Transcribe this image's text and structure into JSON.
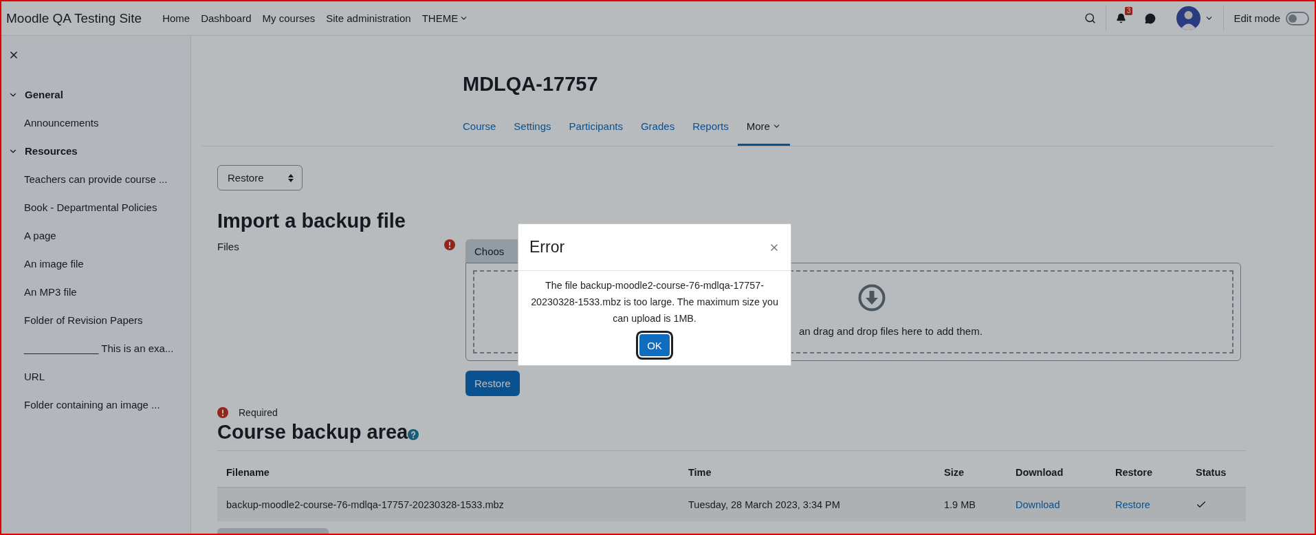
{
  "navbar": {
    "site_name": "Moodle QA Testing Site",
    "links": [
      {
        "label": "Home",
        "dropdown": false
      },
      {
        "label": "Dashboard",
        "dropdown": false
      },
      {
        "label": "My courses",
        "dropdown": false
      },
      {
        "label": "Site administration",
        "dropdown": false
      },
      {
        "label": "THEME",
        "dropdown": true
      }
    ],
    "notification_count": "3",
    "edit_mode": {
      "label": "Edit mode",
      "on": false
    }
  },
  "sidebar": {
    "sections": [
      {
        "title": "General",
        "expanded": true,
        "items": [
          "Announcements"
        ]
      },
      {
        "title": "Resources",
        "expanded": true,
        "items": [
          "Teachers can provide course ...",
          "Book - Departmental Policies",
          "A page",
          "An image file",
          "An MP3 file",
          "Folder of Revision Papers",
          "_____________ This is an exa...",
          "URL",
          "Folder containing an image ..."
        ]
      }
    ]
  },
  "course": {
    "title": "MDLQA-17757",
    "tabs": [
      {
        "label": "Course",
        "selected": false,
        "dropdown": false
      },
      {
        "label": "Settings",
        "selected": false,
        "dropdown": false
      },
      {
        "label": "Participants",
        "selected": false,
        "dropdown": false
      },
      {
        "label": "Grades",
        "selected": false,
        "dropdown": false
      },
      {
        "label": "Reports",
        "selected": false,
        "dropdown": false
      },
      {
        "label": "More",
        "selected": true,
        "dropdown": true
      }
    ]
  },
  "page_select": {
    "value": "Restore"
  },
  "import": {
    "heading": "Import a backup file",
    "files_label": "Files",
    "choose_button": "Choos",
    "drop_text": "an drag and drop files here to add them.",
    "restore_button": "Restore",
    "required_note": "Required"
  },
  "backup_area": {
    "heading": "Course backup area",
    "columns": [
      "Filename",
      "Time",
      "Size",
      "Download",
      "Restore",
      "Status"
    ],
    "rows": [
      {
        "filename": "backup-moodle2-course-76-mdlqa-17757-20230328-1533.mbz",
        "time": "Tuesday, 28 March 2023, 3:34 PM",
        "size": "1.9 MB",
        "download": "Download",
        "restore": "Restore",
        "status_checked": true
      }
    ]
  },
  "dialog": {
    "title": "Error",
    "message": "The file backup-moodle2-course-76-mdlqa-17757-20230328-1533.mbz is too large. The maximum size you can upload is 1MB.",
    "ok_button": "OK"
  }
}
